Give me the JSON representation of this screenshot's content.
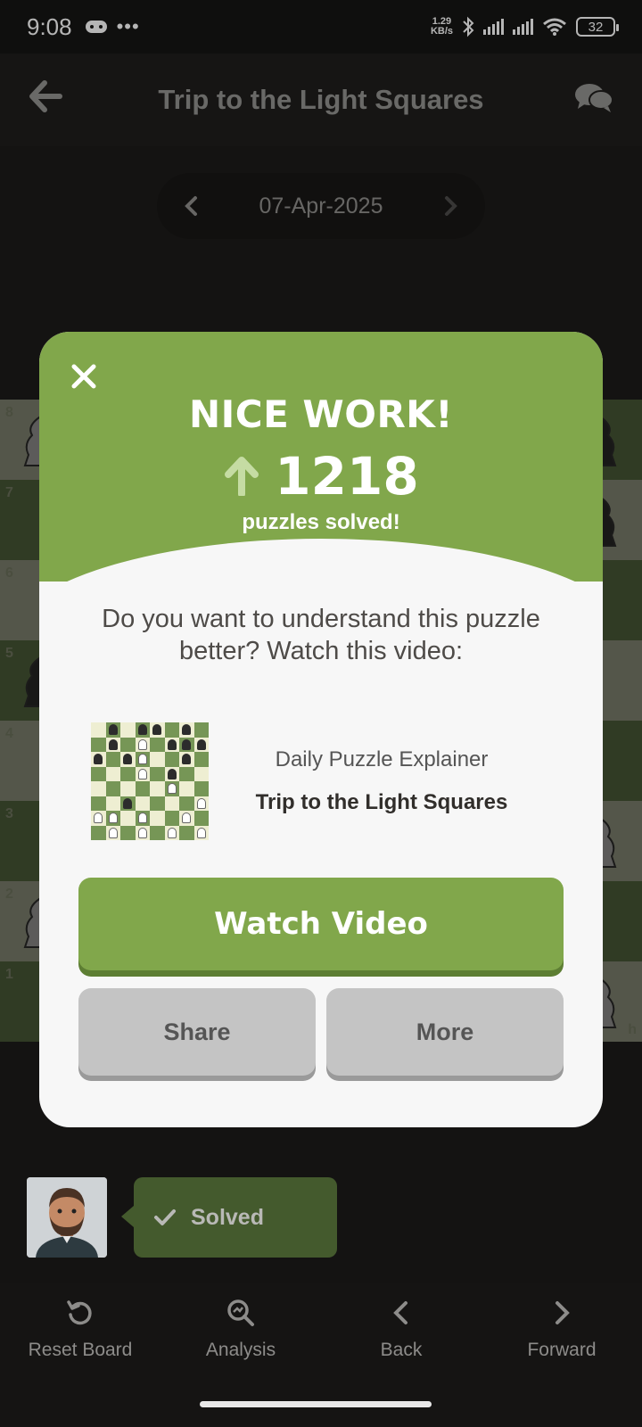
{
  "status_bar": {
    "time": "9:08",
    "net_speed_value": "1.29",
    "net_speed_unit": "KB/s",
    "battery": "32"
  },
  "header": {
    "title": "Trip to the Light Squares",
    "back_icon": "arrow-left-icon",
    "chat_icon": "chat-bubbles-icon"
  },
  "date_nav": {
    "date": "07-Apr-2025",
    "prev_icon": "chevron-left-icon",
    "next_icon": "chevron-right-icon"
  },
  "board": {
    "ranks": [
      "8",
      "7",
      "6",
      "5",
      "4",
      "3",
      "2",
      "1"
    ],
    "file_h": "h"
  },
  "modal": {
    "headline": "NICE WORK!",
    "count": "1218",
    "count_label": "puzzles solved!",
    "question": "Do you want to understand this puzzle better? Watch this video:",
    "video_subtitle": "Daily Puzzle Explainer",
    "video_title": "Trip to the Light Squares",
    "watch_label": "Watch Video",
    "share_label": "Share",
    "more_label": "More",
    "accent_color": "#81a74b"
  },
  "solved_badge": {
    "label": "Solved"
  },
  "bottom_nav": {
    "items": [
      {
        "label": "Reset Board",
        "icon": "reset-icon"
      },
      {
        "label": "Analysis",
        "icon": "analysis-magnifier-icon"
      },
      {
        "label": "Back",
        "icon": "chevron-left-icon"
      },
      {
        "label": "Forward",
        "icon": "chevron-right-icon"
      }
    ]
  }
}
